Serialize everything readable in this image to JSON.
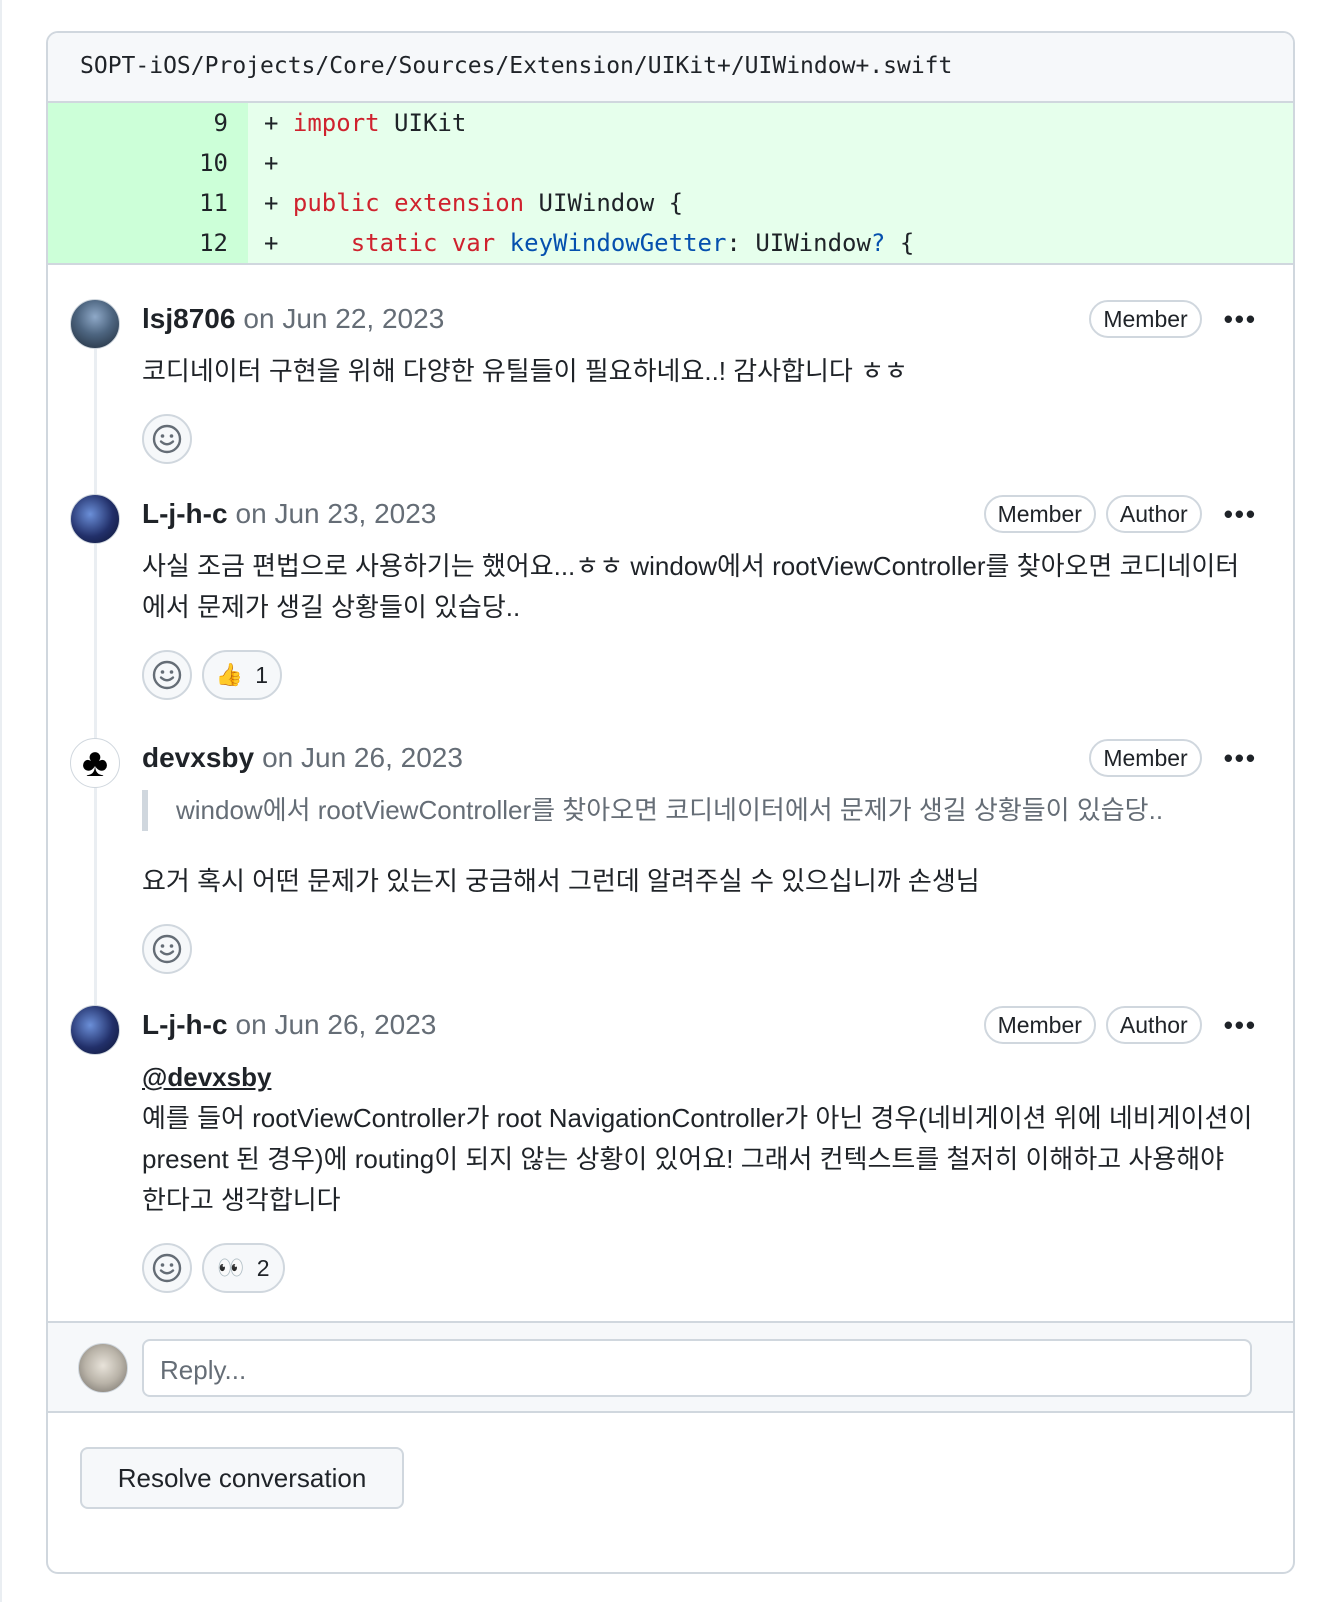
{
  "file": {
    "path": "SOPT-iOS/Projects/Core/Sources/Extension/UIKit+/UIWindow+.swift"
  },
  "diff": [
    {
      "num": "9",
      "prefix": "+ ",
      "tokens": [
        {
          "t": "import",
          "c": "kw"
        },
        {
          "t": " UIKit",
          "c": ""
        }
      ]
    },
    {
      "num": "10",
      "prefix": "+",
      "tokens": []
    },
    {
      "num": "11",
      "prefix": "+ ",
      "tokens": [
        {
          "t": "public",
          "c": "kw"
        },
        {
          "t": " ",
          "c": ""
        },
        {
          "t": "extension",
          "c": "kw"
        },
        {
          "t": " UIWindow {",
          "c": ""
        }
      ]
    },
    {
      "num": "12",
      "prefix": "+     ",
      "tokens": [
        {
          "t": "static",
          "c": "kw"
        },
        {
          "t": " ",
          "c": ""
        },
        {
          "t": "var",
          "c": "kw"
        },
        {
          "t": " ",
          "c": ""
        },
        {
          "t": "keyWindowGetter",
          "c": "ident"
        },
        {
          "t": ": UIWindow",
          "c": ""
        },
        {
          "t": "?",
          "c": "ident"
        },
        {
          "t": " {",
          "c": ""
        }
      ]
    }
  ],
  "comments": [
    {
      "author": "lsj8706",
      "date": "on Jun 22, 2023",
      "badges": [
        "Member"
      ],
      "more": "•••",
      "body": "코디네이터 구현을 위해 다양한 유틸들이 필요하네요..! 감사합니다 ㅎㅎ"
    },
    {
      "author": "L-j-h-c",
      "date": "on Jun 23, 2023",
      "badges": [
        "Member",
        "Author"
      ],
      "more": "•••",
      "body": "사실 조금 편법으로 사용하기는 했어요...ㅎㅎ window에서 rootViewController를 찾아오면 코디네이터에서 문제가 생길 상황들이 있습당..",
      "reaction": {
        "emoji": "👍",
        "count": "1"
      }
    },
    {
      "author": "devxsby",
      "date": "on Jun 26, 2023",
      "badges": [
        "Member"
      ],
      "more": "•••",
      "quote": "window에서 rootViewController를 찾아오면 코디네이터에서 문제가 생길 상황들이 있습당..",
      "body": "요거 혹시 어떤 문제가 있는지 궁금해서 그런데 알려주실 수 있으십니까 손생님"
    },
    {
      "author": "L-j-h-c",
      "date": "on Jun 26, 2023",
      "badges": [
        "Member",
        "Author"
      ],
      "more": "•••",
      "mention": "@devxsby",
      "body": "예를 들어 rootViewController가 root NavigationController가 아닌 경우(네비게이션 위에 네비게이션이 present 된 경우)에 routing이 되지 않는 상황이 있어요! 그래서 컨텍스트를 철저히 이해하고 사용해야 한다고 생각합니다",
      "reaction": {
        "emoji": "👀",
        "count": "2"
      }
    }
  ],
  "reply": {
    "placeholder": "Reply..."
  },
  "resolve": {
    "label": "Resolve conversation"
  },
  "colors": {
    "diff_bg": "#e6ffec",
    "diff_num_bg": "#ccffd8",
    "keyword": "#cf222e",
    "identifier": "#0550ae",
    "border": "#d0d7de"
  }
}
